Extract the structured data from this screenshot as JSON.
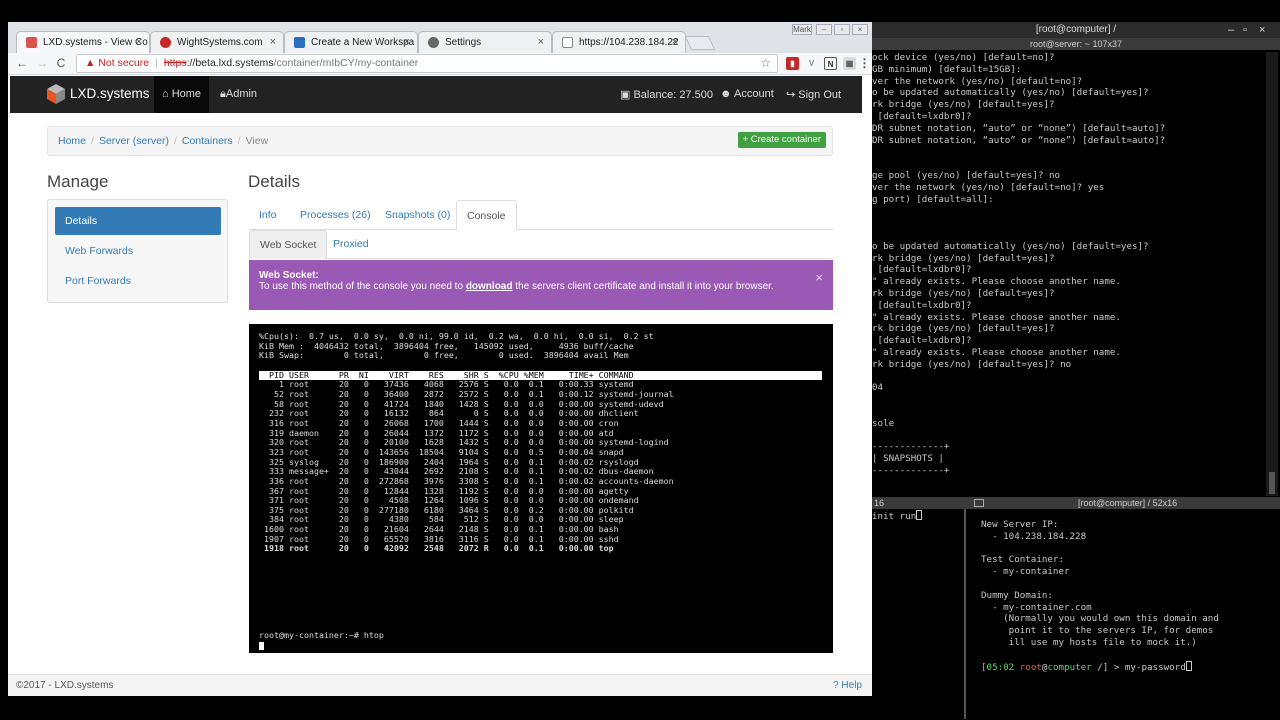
{
  "terminal": {
    "title": "[root@computer] /",
    "subtitle": "root@server: ~ 107x37",
    "controls": [
      "–",
      "▫",
      "×"
    ],
    "top_lines": [
      "ock device (yes/no) [default=no]?",
      "GB minimum) [default=15GB]:",
      "ver the network (yes/no) [default=no]?",
      "o be updated automatically (yes/no) [default=yes]?",
      "rk bridge (yes/no) [default=yes]?",
      " [default=lxdbr0]?",
      "DR subnet notation, “auto” or “none”) [default=auto]?",
      "DR subnet notation, “auto” or “none”) [default=auto]?",
      "",
      "",
      "ge pool (yes/no) [default=yes]? no",
      "ver the network (yes/no) [default=no]? yes",
      "g port) [default=all]:",
      "",
      "",
      "",
      "o be updated automatically (yes/no) [default=yes]?",
      "rk bridge (yes/no) [default=yes]?",
      " [default=lxdbr0]?",
      "\" already exists. Please choose another name.",
      "rk bridge (yes/no) [default=yes]?",
      " [default=lxdbr0]?",
      "\" already exists. Please choose another name.",
      "rk bridge (yes/no) [default=yes]?",
      " [default=lxdbr0]?",
      "\" already exists. Please choose another name.",
      "rk bridge (yes/no) [default=yes]? no",
      "",
      "04",
      "",
      "",
      "sole",
      "",
      "-------------+",
      "| SNAPSHOTS |",
      "-------------+"
    ],
    "pane_bar_left": "16",
    "pane_bar_right": "[root@computer] / 52x16",
    "pane_left_line": "init run",
    "notes": [
      "New Server IP:",
      "  - 104.238.184.228",
      "",
      "Test Container:",
      "  - my-container",
      "",
      "Dummy Domain:",
      "  - my-container.com",
      "    (Normally you would own this domain and",
      "     point it to the servers IP, for demos",
      "     ill use my hosts file to mock it.)"
    ],
    "prompt_time": "[05:02",
    "prompt_user": "root",
    "prompt_at": "@",
    "prompt_host": "computer",
    "prompt_rest": " /] > my-password"
  },
  "browser": {
    "tabs": [
      {
        "label": "LXD.systems - View Co",
        "color": "#d9534f"
      },
      {
        "label": "WightSystems.com",
        "color": "#c62828"
      },
      {
        "label": "Create a New Workspa",
        "color": "#2a6fbf"
      },
      {
        "label": "Settings",
        "color": "#666666"
      },
      {
        "label": "https://104.238.184.22",
        "color": "#888888"
      }
    ],
    "tab_close": "×",
    "window_user_badge": "Mark",
    "url": {
      "warning": "Not secure",
      "scheme": "https",
      "host": "://beta.lxd.systems",
      "path": "/container/mIbCY/my-container"
    },
    "icons": {
      "back": "←",
      "forward": "→",
      "reload": "C",
      "star": "☆",
      "menu": "⋮"
    }
  },
  "site": {
    "brand": "LXD.systems",
    "nav": {
      "home": "Home",
      "admin": "Admin",
      "balance": "Balance: 27.500",
      "account": "Account",
      "signout": "Sign Out"
    },
    "breadcrumb": [
      "Home",
      "Server (server)",
      "Containers",
      "View"
    ],
    "breadcrumb_sep": "/",
    "create_button": "+ Create container",
    "manage_title": "Manage",
    "manage_items": [
      "Details",
      "Web Forwards",
      "Port Forwards"
    ],
    "details_title": "Details",
    "tabs": [
      "Info",
      "Processes (26)",
      "Snapshots (0)",
      "Console"
    ],
    "subtabs": [
      "Web Socket",
      "Proxied"
    ],
    "alert": {
      "title": "Web Socket:",
      "text_before": "To use this method of the console you need to ",
      "link": "download",
      "text_after": " the servers client certificate and install it into your browser.",
      "close": "×"
    },
    "console": {
      "summary": [
        "%Cpu(s):  0.7 us,  0.0 sy,  0.0 ni, 99.0 id,  0.2 wa,  0.0 hi,  0.0 si,  0.2 st",
        "KiB Mem :  4046432 total,  3896404 free,   145092 used,     4936 buff/cache",
        "KiB Swap:        0 total,        0 free,        0 used.  3896404 avail Mem"
      ],
      "header": "  PID USER      PR  NI    VIRT    RES    SHR S  %CPU %MEM     TIME+ COMMAND",
      "rows": [
        "    1 root      20   0   37436   4068   2576 S   0.0  0.1   0:00.33 systemd",
        "   52 root      20   0   36400   2872   2572 S   0.0  0.1   0:00.12 systemd-journal",
        "   58 root      20   0   41724   1840   1428 S   0.0  0.0   0:00.00 systemd-udevd",
        "  232 root      20   0   16132    864      0 S   0.0  0.0   0:00.00 dhclient",
        "  316 root      20   0   26068   1700   1444 S   0.0  0.0   0:00.00 cron",
        "  319 daemon    20   0   26044   1372   1172 S   0.0  0.0   0:00.00 atd",
        "  320 root      20   0   20100   1628   1432 S   0.0  0.0   0:00.00 systemd-logind",
        "  323 root      20   0  143656  18504   9104 S   0.0  0.5   0:00.04 snapd",
        "  325 syslog    20   0  186900   2404   1964 S   0.0  0.1   0:00.02 rsyslogd",
        "  333 message+  20   0   43044   2692   2108 S   0.0  0.1   0:00.02 dbus-daemon",
        "  336 root      20   0  272868   3976   3308 S   0.0  0.1   0:00.02 accounts-daemon",
        "  367 root      20   0   12844   1328   1192 S   0.0  0.0   0:00.00 agetty",
        "  371 root      20   0    4508   1264   1096 S   0.0  0.0   0:00.00 ondemand",
        "  375 root      20   0  277180   6180   3464 S   0.0  0.2   0:00.00 polkitd",
        "  384 root      20   0    4380    584    512 S   0.0  0.0   0:00.00 sleep",
        " 1600 root      20   0   21604   2644   2148 S   0.0  0.1   0:00.00 bash",
        " 1907 root      20   0   65520   3816   3116 S   0.0  0.1   0:00.00 sshd",
        " 1918 root      20   0   42092   2548   2072 R   0.0  0.1   0:00.00 top"
      ],
      "prompt": "root@my-container:~# htop"
    },
    "footer": "©2017 - LXD.systems",
    "help": "Help"
  },
  "colors": {
    "primary": "#337ab7",
    "success": "#3fa13f",
    "alert": "#9b59b6",
    "navbar": "#222222"
  }
}
